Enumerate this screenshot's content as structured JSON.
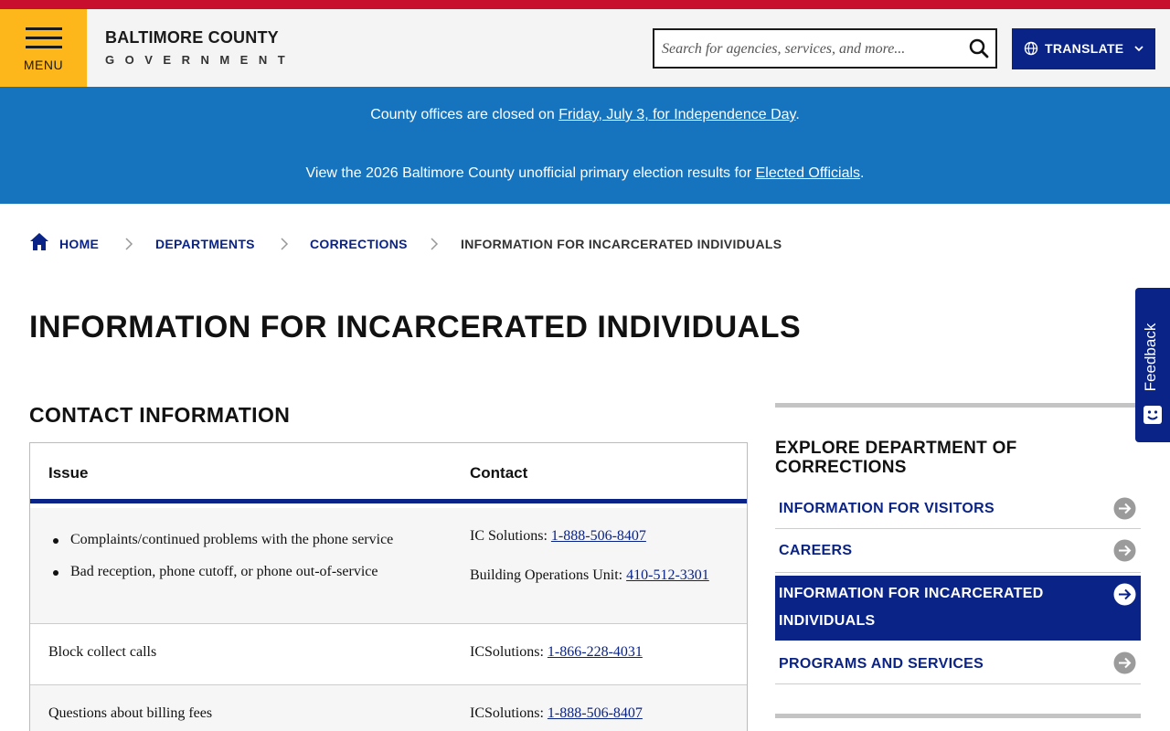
{
  "colors": {
    "top_bar": "#c8102e",
    "header_bg": "#f4f4f4",
    "menu_bg": "#fdb71a",
    "navy": "#0a2387",
    "alert_bg": "#1574bd"
  },
  "header": {
    "menu_label": "MENU",
    "logo_title": "BALTIMORE COUNTY",
    "logo_subtitle": "GOVERNMENT",
    "search_placeholder": "Search for agencies, services, and more...",
    "search_icon": "search-icon",
    "translate_label": "TRANSLATE",
    "translate_icons": [
      "globe-icon",
      "chevron-down-icon"
    ]
  },
  "alert": {
    "line1_prefix": "County offices are closed on ",
    "line1_link": "Friday, July 3, for Independence Day",
    "line1_suffix": ".",
    "line2_prefix": "View the 2026 Baltimore County unofficial primary election results for ",
    "line2_link": "Elected Officials",
    "line2_suffix": "."
  },
  "breadcrumb": {
    "home_icon": "home-icon",
    "items": [
      "HOME",
      "DEPARTMENTS",
      "CORRECTIONS",
      "INFORMATION FOR INCARCERATED INDIVIDUALS"
    ]
  },
  "page_title": "INFORMATION FOR INCARCERATED INDIVIDUALS",
  "contact": {
    "section_title": "CONTACT INFORMATION",
    "headers": [
      "Issue",
      "Contact"
    ],
    "rows": [
      {
        "issues": [
          "Complaints/continued problems with the phone service",
          "Bad reception, phone cutoff, or phone out-of-service"
        ],
        "contacts": [
          {
            "label": "IC Solutions: ",
            "phone": "1-888-506-8407"
          },
          {
            "label": "Building Operations Unit: ",
            "phone": "410-512-3301"
          }
        ]
      },
      {
        "issue": "Block collect calls",
        "contact": {
          "label": "ICSolutions: ",
          "phone": "1-866-228-4031"
        }
      },
      {
        "issue": "Questions about billing fees",
        "contact": {
          "label": "ICSolutions: ",
          "phone": "1-888-506-8407"
        }
      }
    ]
  },
  "sidebar": {
    "heading": "EXPLORE DEPARTMENT OF CORRECTIONS",
    "items": [
      {
        "label": "INFORMATION FOR VISITORS",
        "active": false
      },
      {
        "label": "CAREERS",
        "active": false
      },
      {
        "label": "INFORMATION FOR INCARCERATED INDIVIDUALS",
        "active": true
      },
      {
        "label": "PROGRAMS AND SERVICES",
        "active": false
      }
    ],
    "arrow_icon": "arrow-circle-right-icon"
  },
  "feedback": {
    "label": "Feedback",
    "icon": "feedback-smile-icon"
  }
}
